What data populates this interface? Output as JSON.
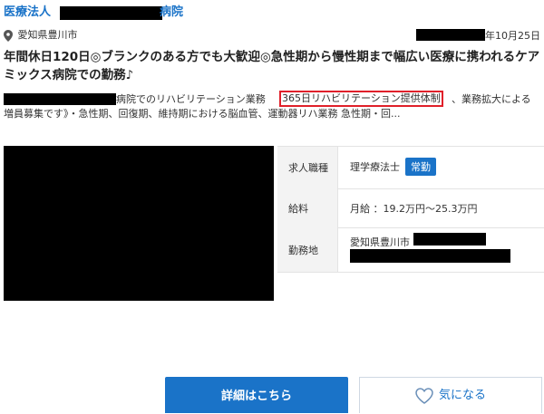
{
  "header": {
    "org_prefix": "医療法人",
    "org_suffix": "病院"
  },
  "location": "愛知県豊川市",
  "date_suffix": "年10月25日",
  "headline": "年間休日120日◎ブランクのある方でも大歓迎◎急性期から慢性期まで幅広い医療に携われるケアミックス病院での勤務♪",
  "description": {
    "part1": "病院でのリハビリテーション業務",
    "highlight": "365日リハビリテーション提供体制",
    "part2": "、業務拡大による",
    "line2": "増員募集です》・急性期、回復期、維持期における脳血管、運動器リハ業務 急性期・回..."
  },
  "info": {
    "rows": [
      {
        "key": "求人職種",
        "value": "理学療法士",
        "badge": "常勤"
      },
      {
        "key": "給料",
        "value": "月給 ：19.2万円〜25.3万円"
      },
      {
        "key": "勤務地",
        "value": "愛知県豊川市"
      }
    ]
  },
  "buttons": {
    "detail": "詳細はこちら",
    "favorite": "気になる"
  },
  "colors": {
    "accent": "#1a73c8",
    "highlight_border": "#e0202a"
  }
}
